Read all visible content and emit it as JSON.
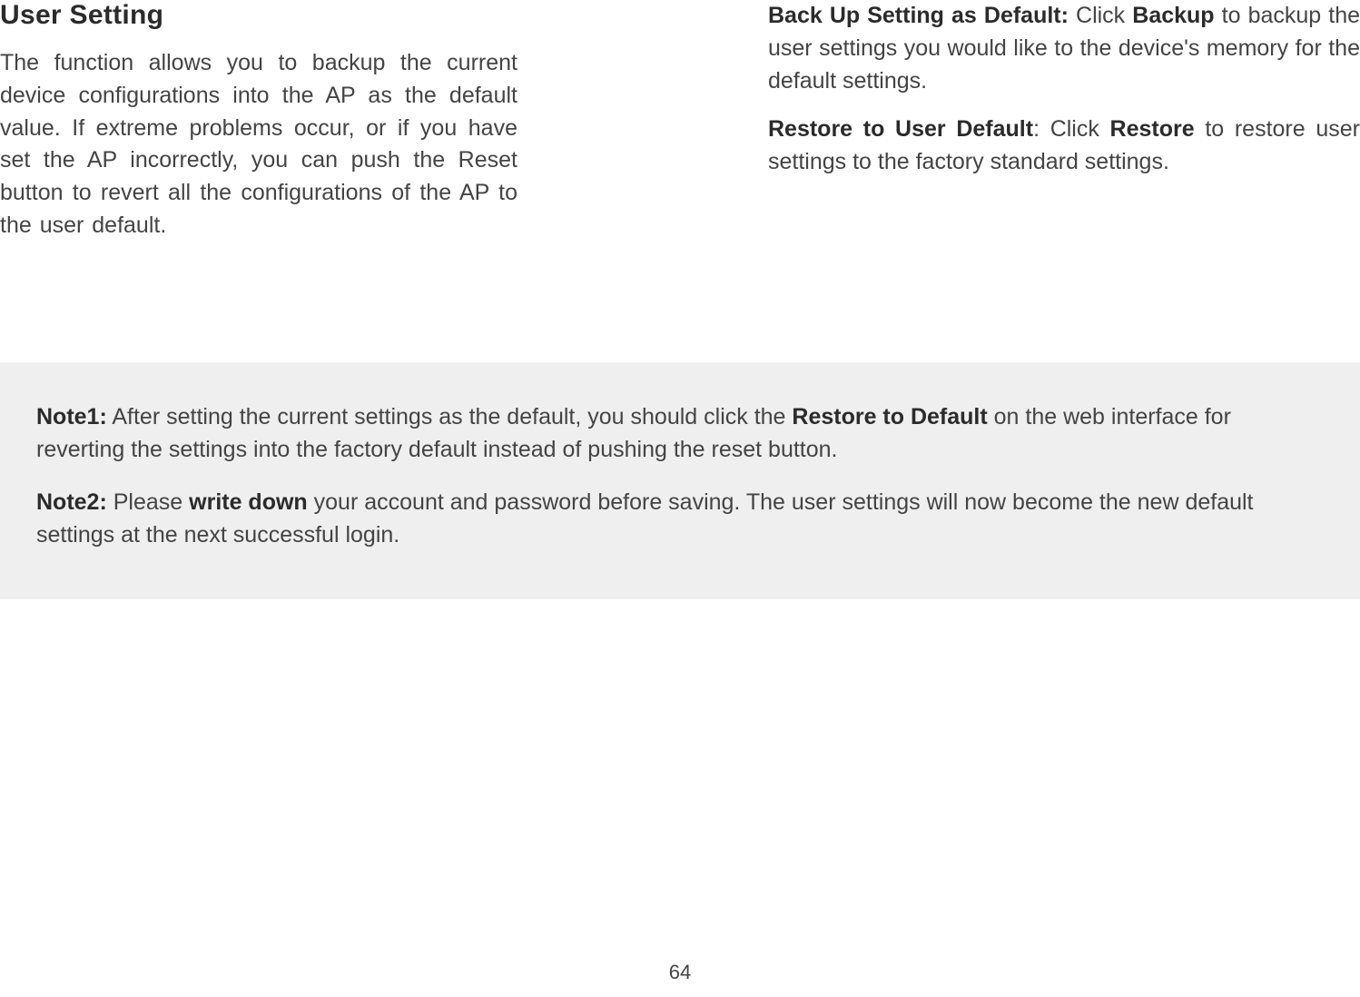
{
  "left": {
    "title": "User Setting",
    "paragraph": "The function allows you to backup the current device configurations into the AP as the default value. If extreme problems occur, or if you have set the AP incorrectly, you can push the Reset button to revert all the configurations of the AP to the user default."
  },
  "right": {
    "para1": {
      "bold1": "Back Up Setting as Default:",
      "text1": "  Click ",
      "bold2": "Backup",
      "text2": " to backup the user settings you would like to the device's memory for the default settings."
    },
    "para2": {
      "bold1": "Restore to User Default",
      "text1": ": Click ",
      "bold2": "Restore",
      "text2": " to restore user settings to the factory standard settings."
    }
  },
  "notes": {
    "note1": {
      "label": "Note1:",
      "text1": " After setting the current settings as the default, you should click the ",
      "bold1": "Restore to Default",
      "text2": " on the web interface for reverting the settings into the factory default instead of pushing the reset button."
    },
    "note2": {
      "label": "Note2:",
      "text1": " Please ",
      "bold1": "write down",
      "text2": " your account and password before saving. The user settings will now become the new default settings at the next successful login."
    }
  },
  "page_number": "64"
}
